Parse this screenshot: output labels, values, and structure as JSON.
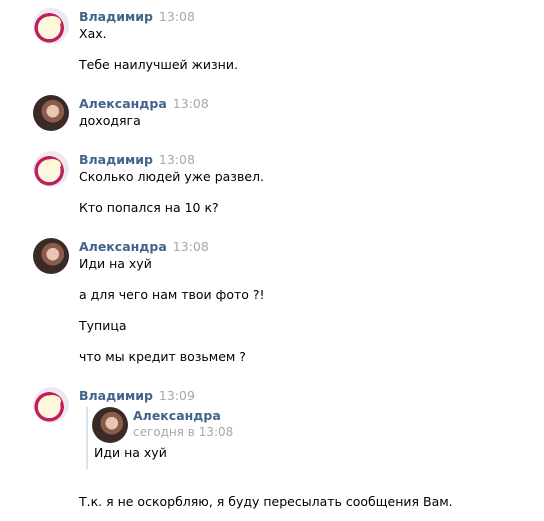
{
  "messages": [
    {
      "author": "Владимир",
      "time": "13:08",
      "avatar": "vladimir-avatar",
      "lines": [
        "Хах.",
        "Тебе наилучшей жизни."
      ]
    },
    {
      "author": "Александра",
      "time": "13:08",
      "avatar": "aleksandra-avatar",
      "lines": [
        "доходяга"
      ]
    },
    {
      "author": "Владимир",
      "time": "13:08",
      "avatar": "vladimir-avatar",
      "lines": [
        "Сколько людей уже развел.",
        "Кто попался на 10 к?"
      ]
    },
    {
      "author": "Александра",
      "time": "13:08",
      "avatar": "aleksandra-avatar",
      "lines": [
        "Иди на хуй",
        "а для чего нам твои фото ?!",
        "Тупица",
        "что мы кредит возьмем ?"
      ]
    },
    {
      "author": "Владимир",
      "time": "13:09",
      "avatar": "vladimir-avatar",
      "forwarded": {
        "author": "Александра",
        "time": "сегодня в 13:08",
        "text": "Иди на хуй"
      },
      "lines": [
        "Т.к. я не оскорбляю, я буду пересылать сообщения Вам."
      ]
    }
  ],
  "colors": {
    "author": "#42648b",
    "time": "#a8a8a8",
    "text": "#000000",
    "forward_border": "#dae2ea"
  }
}
